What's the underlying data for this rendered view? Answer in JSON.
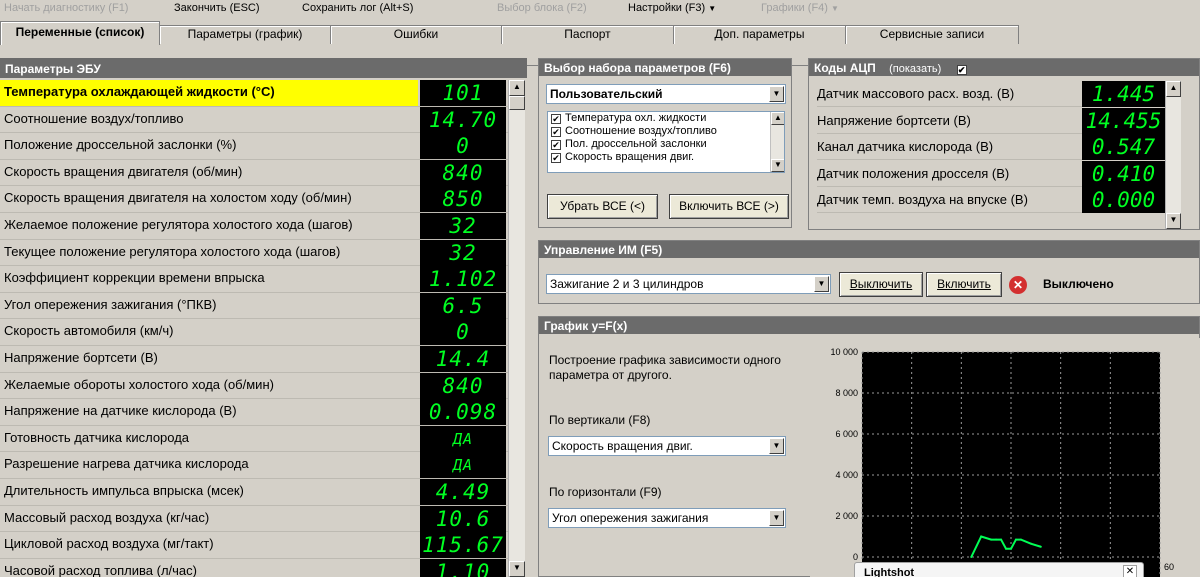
{
  "menubar": {
    "start_diag": "Начать диагностику (F1)",
    "finish": "Закончить (ESC)",
    "save_log": "Сохранить лог (Alt+S)",
    "select_block": "Выбор блока (F2)",
    "settings": "Настройки (F3)",
    "graphs": "Графики (F4)"
  },
  "tabs": [
    "Переменные (список)",
    "Параметры (график)",
    "Ошибки",
    "Паспорт",
    "Доп. параметры",
    "Сервисные записи"
  ],
  "ecu": {
    "header": "Параметры ЭБУ",
    "params": [
      {
        "label": "Температура охлаждающей жидкости (°С)",
        "value": "101"
      },
      {
        "label": "Соотношение воздух/топливо",
        "value": "14.70"
      },
      {
        "label": "Положение дроссельной заслонки (%)",
        "value": "0"
      },
      {
        "label": "Скорость вращения двигателя (об/мин)",
        "value": "840"
      },
      {
        "label": "Скорость вращения двигателя на холостом ходу (об/мин)",
        "value": "850"
      },
      {
        "label": "Желаемое положение регулятора холостого хода (шагов)",
        "value": "32"
      },
      {
        "label": "Текущее положение регулятора холостого хода (шагов)",
        "value": "32"
      },
      {
        "label": "Коэффициент коррекции времени впрыска",
        "value": "1.102"
      },
      {
        "label": "Угол опережения зажигания (°ПКВ)",
        "value": "6.5"
      },
      {
        "label": "Скорость автомобиля (км/ч)",
        "value": "0"
      },
      {
        "label": "Напряжение бортсети (В)",
        "value": "14.4"
      },
      {
        "label": "Желаемые обороты холостого хода (об/мин)",
        "value": "840"
      },
      {
        "label": "Напряжение на датчике кислорода (В)",
        "value": "0.098"
      },
      {
        "label": "Готовность датчика кислорода",
        "value": "ДА"
      },
      {
        "label": "Разрешение нагрева датчика кислорода",
        "value": "ДА"
      },
      {
        "label": "Длительность импульса впрыска (мсек)",
        "value": "4.49"
      },
      {
        "label": "Массовый расход воздуха (кг/час)",
        "value": "10.6"
      },
      {
        "label": "Цикловой расход воздуха (мг/такт)",
        "value": "115.67"
      },
      {
        "label": "Часовой расход топлива (л/час)",
        "value": "1.10"
      }
    ]
  },
  "paramset": {
    "header": "Выбор набора параметров (F6)",
    "selected": "Пользовательский",
    "items": [
      "Температура охл. жидкости",
      "Соотношение воздух/топливо",
      "Пол. дроссельной заслонки",
      "Скорость вращения двиг."
    ],
    "remove_all": "Убрать ВСЕ (<)",
    "add_all": "Включить ВСЕ (>)"
  },
  "adc": {
    "header": "Коды АЦП",
    "show_label": "(показать)",
    "rows": [
      {
        "label": "Датчик массового расх. возд. (В)",
        "value": "1.445"
      },
      {
        "label": "Напряжение бортсети (В)",
        "value": "14.455"
      },
      {
        "label": "Канал датчика кислорода (В)",
        "value": "0.547"
      },
      {
        "label": "Датчик положения дросселя (В)",
        "value": "0.410"
      },
      {
        "label": "Датчик темп. воздуха на впуске (В)",
        "value": "0.000"
      }
    ]
  },
  "control": {
    "header": "Управление ИМ (F5)",
    "selected": "Зажигание 2 и 3 цилиндров",
    "off_button": "Выключить",
    "on_button": "Включить",
    "status": "Выключено",
    "status_color": "#d32f2f"
  },
  "graph": {
    "header": "График y=F(x)",
    "description": "Построение графика зависимости одного параметра от другого.",
    "vertical_label": "По вертикали (F8)",
    "vertical_value": "Скорость вращения двиг.",
    "horizontal_label": "По горизонтали (F9)",
    "horizontal_value": "Угол опережения зажигания"
  },
  "chart_data": {
    "type": "line",
    "x": [
      22,
      24,
      26,
      27,
      28,
      29,
      30,
      31,
      32,
      34,
      36
    ],
    "y": [
      0,
      1000,
      850,
      850,
      850,
      400,
      400,
      850,
      850,
      650,
      500
    ],
    "xlim": [
      0,
      60
    ],
    "ylim": [
      0,
      10000
    ],
    "y_ticks": [
      "10 000",
      "8 000",
      "6 000",
      "4 000",
      "2 000",
      "0"
    ],
    "x_ticks": [
      "60"
    ],
    "line_color": "#00ff55",
    "background": "#000000",
    "grid": true,
    "title": "",
    "xlabel": "",
    "ylabel": ""
  },
  "lightshot": {
    "title": "Lightshot"
  }
}
